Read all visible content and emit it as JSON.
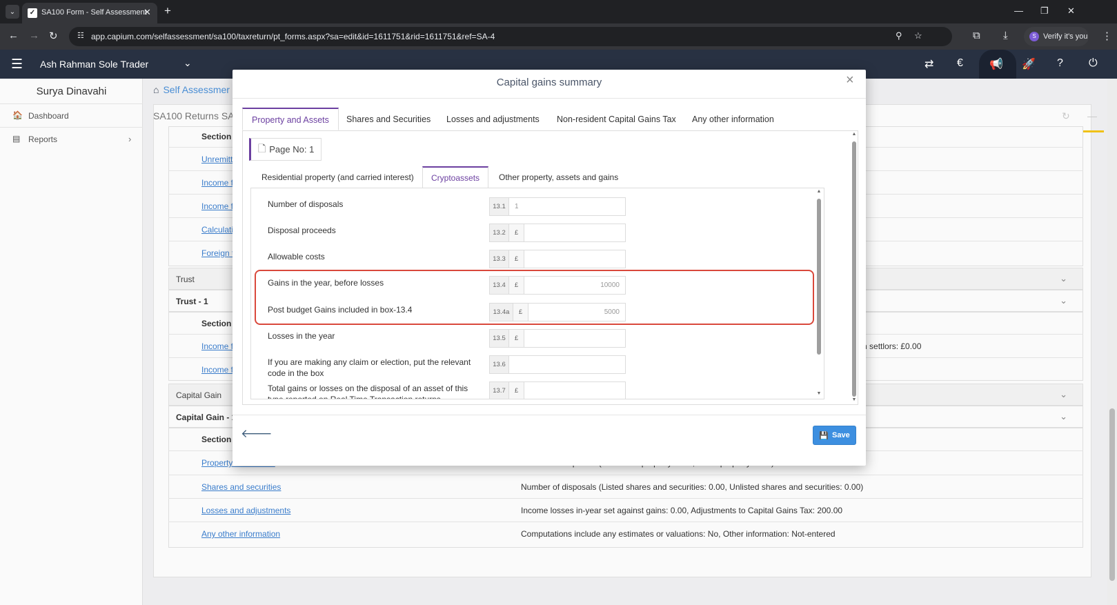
{
  "browser": {
    "tab_title": "SA100 Form - Self Assessment",
    "url": "app.capium.com/selfassessment/sa100/taxreturn/pt_forms.aspx?sa=edit&id=1611751&rid=1611751&ref=SA-4",
    "verify_label": "Verify it's you"
  },
  "header": {
    "client_name": "Ash Rahman Sole Trader",
    "icons": [
      "switch-icon",
      "currency-icon",
      "announce-icon",
      "rocket-icon",
      "help-icon",
      "power-icon"
    ]
  },
  "sidebar": {
    "user_name": "Surya Dinavahi",
    "items": [
      {
        "label": "Dashboard",
        "icon": "dashboard-icon"
      },
      {
        "label": "Reports",
        "icon": "report-icon"
      }
    ]
  },
  "background": {
    "breadcrumb": "Self Assessmer",
    "returns_title": "SA100 Returns SA",
    "section_header": "Section",
    "top_links": [
      "Unremitt",
      "Income f",
      "Income f",
      "Calculati",
      "Foreign t"
    ],
    "trust_group": "Trust",
    "trust_sub": "Trust - 1",
    "trust_links": [
      "Income f",
      "Income f"
    ],
    "trust_desc_tail": "ile on settlors: £0.00",
    "cg_group": "Capital Gain",
    "cg_sub": "Capital Gain - 1",
    "cg_rows": [
      {
        "link": "Property and assets",
        "desc": "Number of disposals (residential property: 0.00, Other property: 0.00)"
      },
      {
        "link": "Shares and securities",
        "desc": "Number of disposals (Listed shares and securities: 0.00, Unlisted shares and securities: 0.00)"
      },
      {
        "link": "Losses and adjustments",
        "desc": "Income losses in-year set against gains: 0.00, Adjustments to Capital Gains Tax: 200.00"
      },
      {
        "link": "Any other information",
        "desc": "Computations include any estimates or valuations: No, Other information: Not-entered"
      }
    ]
  },
  "modal": {
    "title": "Capital gains summary",
    "tabs": [
      "Property and Assets",
      "Shares and Securities",
      "Losses and adjustments",
      "Non-resident Capital Gains Tax",
      "Any other information"
    ],
    "page_no": "Page No: 1",
    "sub_tabs": [
      "Residential property (and carried interest)",
      "Cryptoassets",
      "Other property, assets and gains"
    ],
    "rows": [
      {
        "label": "Number of disposals",
        "box": "13.1",
        "pound": "",
        "value": "1"
      },
      {
        "label": "Disposal proceeds",
        "box": "13.2",
        "pound": "£",
        "value": ""
      },
      {
        "label": "Allowable costs",
        "box": "13.3",
        "pound": "£",
        "value": ""
      },
      {
        "label": "Gains in the year, before losses",
        "box": "13.4",
        "pound": "£",
        "value": "10000"
      },
      {
        "label": "Post budget Gains included in box-13.4",
        "box": "13.4a",
        "pound": "£",
        "value": "5000"
      },
      {
        "label": "Losses in the year",
        "box": "13.5",
        "pound": "£",
        "value": ""
      },
      {
        "label": "If you are making any claim or election, put the relevant code in the box",
        "box": "13.6",
        "pound": "",
        "value": ""
      },
      {
        "label": "Total gains or losses on the disposal of an asset of this type reported on Real Time Transaction returns",
        "box": "13.7",
        "pound": "£",
        "value": ""
      }
    ],
    "save_label": "Save"
  },
  "colors": {
    "accent_purple": "#6b3fa0",
    "header_bg": "#283142",
    "save_blue": "#3d8fe0",
    "highlight_red": "#d9483b"
  }
}
